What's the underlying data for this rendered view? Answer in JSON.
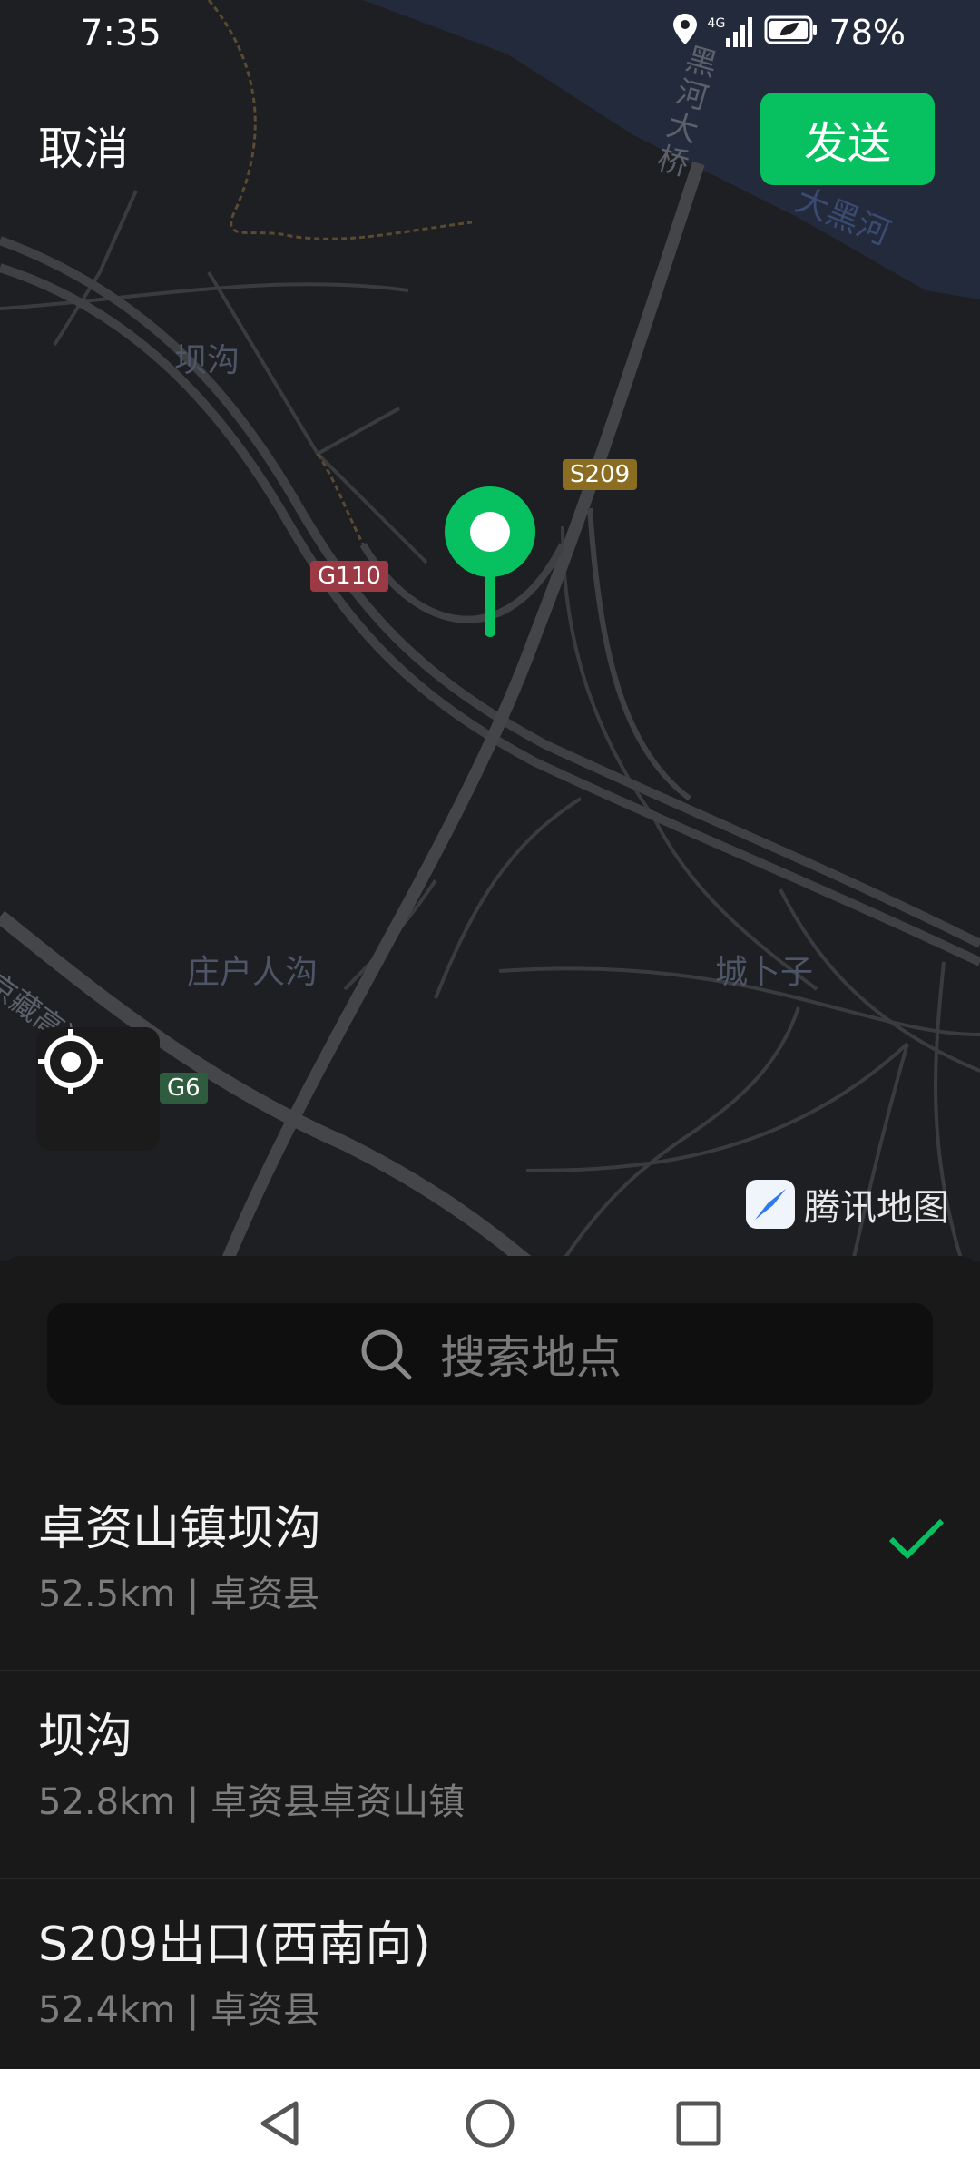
{
  "status": {
    "time": "7:35",
    "network": "4G",
    "battery": "78%"
  },
  "header": {
    "cancel_label": "取消",
    "send_label": "发送",
    "send_color": "#07c160"
  },
  "map": {
    "labels": {
      "place_bagou": "坝沟",
      "place_zhuanghu": "庄户人沟",
      "place_chengbuzi": "城卜子",
      "bridge": "黑河大桥",
      "river": "大黑河",
      "expressway": "京藏高速"
    },
    "shields": {
      "s209": "S209",
      "g110": "G110",
      "g6": "G6"
    },
    "brand": "腾讯地图"
  },
  "search": {
    "placeholder": "搜索地点"
  },
  "results": [
    {
      "title": "卓资山镇坝沟",
      "subtitle": "52.5km | 卓资县",
      "selected": true
    },
    {
      "title": "坝沟",
      "subtitle": "52.8km | 卓资县卓资山镇",
      "selected": false
    },
    {
      "title": "S209出口(西南向)",
      "subtitle": "52.4km | 卓资县",
      "selected": false
    }
  ]
}
